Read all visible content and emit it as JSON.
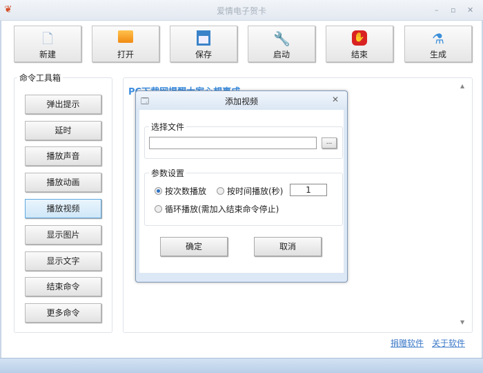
{
  "window": {
    "title": "爱情电子贺卡"
  },
  "toolbar": [
    {
      "label": "新建",
      "icon": "new-file-icon"
    },
    {
      "label": "打开",
      "icon": "folder-icon"
    },
    {
      "label": "保存",
      "icon": "save-icon"
    },
    {
      "label": "启动",
      "icon": "wrench-icon"
    },
    {
      "label": "结束",
      "icon": "stop-icon"
    },
    {
      "label": "生成",
      "icon": "flask-icon"
    }
  ],
  "toolbox": {
    "title": "命令工具箱",
    "items": [
      "弹出提示",
      "延时",
      "播放声音",
      "播放动画",
      "播放视频",
      "显示图片",
      "显示文字",
      "结束命令",
      "更多命令"
    ],
    "active": "播放视频"
  },
  "preview": {
    "text": "PC下载网提醒大家心想事成"
  },
  "dialog": {
    "title": "添加视频",
    "file_group": "选择文件",
    "file_value": "",
    "browse_label": "...",
    "params_group": "参数设置",
    "opt_count": "按次数播放",
    "opt_time": "按时间播放(秒)",
    "time_value": "1",
    "opt_loop": "循环播放(需加入结束命令停止)",
    "ok": "确定",
    "cancel": "取消"
  },
  "links": {
    "donate": "捐赠软件",
    "about": "关于软件"
  }
}
